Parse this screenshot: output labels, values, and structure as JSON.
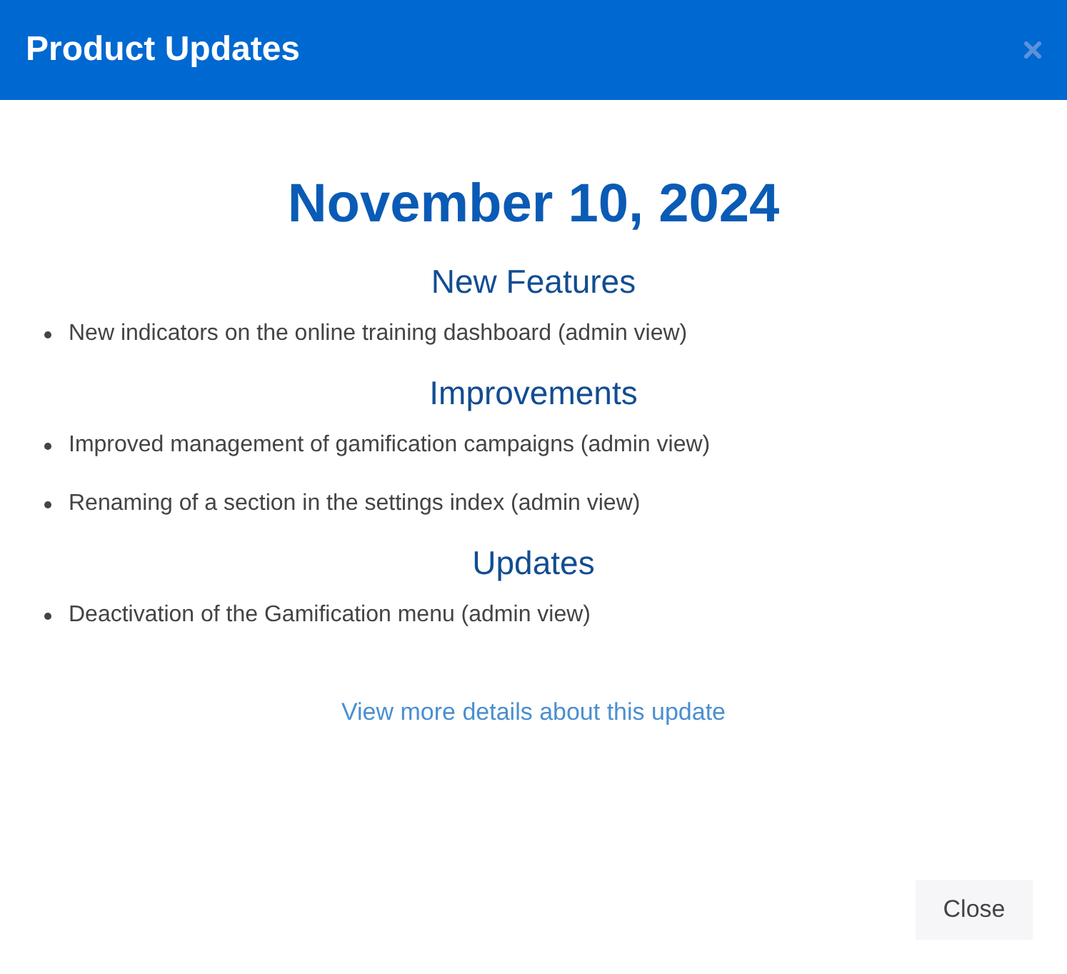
{
  "window": {
    "title": "Product Updates"
  },
  "date": "November 10, 2024",
  "sections": [
    {
      "heading": "New Features",
      "items": [
        "New indicators on the online training dashboard (admin view)"
      ]
    },
    {
      "heading": "Improvements",
      "items": [
        "Improved management of gamification campaigns (admin view)",
        "Renaming of a section in the settings index (admin view)"
      ]
    },
    {
      "heading": "Updates",
      "items": [
        "Deactivation of the Gamification menu (admin view)"
      ]
    }
  ],
  "link": "View more details about this update",
  "buttons": [
    "Close"
  ]
}
